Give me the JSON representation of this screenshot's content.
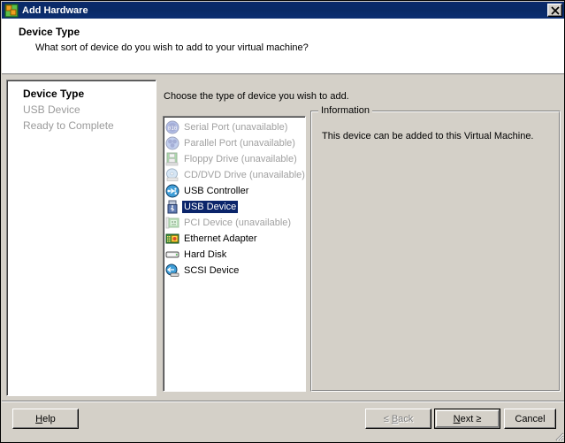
{
  "window": {
    "title": "Add Hardware",
    "title_icon": "add-hardware-icon",
    "close_icon": "close-icon"
  },
  "header": {
    "title": "Device Type",
    "subtitle": "What sort of device do you wish to add to your virtual machine?"
  },
  "steps": {
    "items": [
      {
        "label": "Device Type",
        "state": "current"
      },
      {
        "label": "USB Device",
        "state": "pending"
      },
      {
        "label": "Ready to Complete",
        "state": "pending"
      }
    ]
  },
  "main": {
    "choose_label": "Choose the type of device you wish to add.",
    "devices": [
      {
        "label": "Serial Port (unavailable)",
        "icon": "serial-port-icon",
        "disabled": true,
        "selected": false
      },
      {
        "label": "Parallel Port (unavailable)",
        "icon": "parallel-port-icon",
        "disabled": true,
        "selected": false
      },
      {
        "label": "Floppy Drive (unavailable)",
        "icon": "floppy-drive-icon",
        "disabled": true,
        "selected": false
      },
      {
        "label": "CD/DVD Drive (unavailable)",
        "icon": "cd-dvd-drive-icon",
        "disabled": true,
        "selected": false
      },
      {
        "label": "USB Controller",
        "icon": "usb-controller-icon",
        "disabled": false,
        "selected": false
      },
      {
        "label": "USB Device",
        "icon": "usb-device-icon",
        "disabled": false,
        "selected": true
      },
      {
        "label": "PCI Device (unavailable)",
        "icon": "pci-device-icon",
        "disabled": true,
        "selected": false
      },
      {
        "label": "Ethernet Adapter",
        "icon": "ethernet-adapter-icon",
        "disabled": false,
        "selected": false
      },
      {
        "label": "Hard Disk",
        "icon": "hard-disk-icon",
        "disabled": false,
        "selected": false
      },
      {
        "label": "SCSI Device",
        "icon": "scsi-device-icon",
        "disabled": false,
        "selected": false
      }
    ]
  },
  "information": {
    "legend": "Information",
    "text": "This device can be added to this Virtual Machine."
  },
  "footer": {
    "help": "Help",
    "back": "< Back",
    "back_prefix": "≤",
    "back_text": "Back",
    "next_text": "Next",
    "next_suffix": "≥",
    "cancel": "Cancel",
    "back_disabled": true,
    "next_default": true
  },
  "colors": {
    "titlebar": "#0b2a6b",
    "face": "#d4d0c8",
    "selection": "#0a246a",
    "disabled_text": "#a0a0a0"
  }
}
